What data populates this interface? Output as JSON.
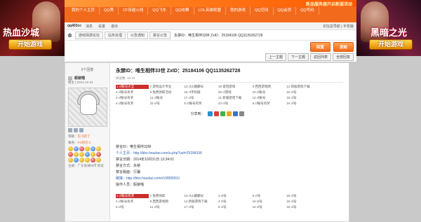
{
  "ads": {
    "left_title": "热血沙城",
    "left_button": "开始游戏",
    "right_title": "黑暗之光",
    "right_button": "开始游戏"
  },
  "top": {
    "banner_text": "新品服务器开启新服活动",
    "nav": [
      "我的个人主页",
      "QQ秀",
      "CF穿越火线",
      "QQ飞车",
      "QQ炫舞",
      "LOL英雄联盟",
      "我的游戏",
      "QQ空间",
      "QQ会员",
      "QQ号码"
    ]
  },
  "userbar": {
    "username": "qq403cc",
    "items": [
      "消息",
      "设置",
      "退出"
    ],
    "right": "论坛总导航 | 手机版"
  },
  "breadcrumb": {
    "items": [
      "游戏情感论坛",
      "站务处理",
      "公告通知",
      "禁言公告"
    ],
    "title": "永禁ID：唯生相伴33世  ZxID：25184106  QQ1135262728"
  },
  "actions": {
    "reply": "回复",
    "post": "发帖"
  },
  "pager": {
    "prev": "上一主题",
    "next": "下一主题",
    "back": "返回列表",
    "all": "全部回复"
  },
  "post": {
    "floor": "0个回复",
    "uid": "楼主 | 2014-10-31",
    "author": "假装喵",
    "rank_label": "等级：",
    "rank_value": "实习新丁",
    "role_label": "角色：",
    "role_value": "PK新社人",
    "location": "注册：广东省潮州市 新浪",
    "title": "永禁ID：唯生相伴33世  ZxID：25184106  QQ1135262728",
    "meta": "阅读数: 10-31",
    "share_label": "分享到：",
    "body_lines": [
      "禁言ID：唯生相伴33世",
      "个人主页：http://bbs.houdao.com/u.php?uid=25184106",
      "禁言日期：2014年10月31日  13:34:01",
      "禁言方式：永禁",
      "禁言版面：行骗",
      "链接：http://bbs.houdao.com/r10892061/",
      "操作人员：假装喵"
    ],
    "ad_links_top": [
      "1 cf账号大全",
      "2 cf账号有奖",
      "3 cf账号有奖",
      "4 cf账号有奖",
      "5 cf账号有奖",
      "6 cf账号有奖",
      "7 游戏设计专业",
      "8 西西游戏网",
      "9 免费领取活动",
      "10 cf账号",
      "11 cf账号",
      "12 cf账号",
      "13 cf火麒麟号",
      "14 新服游戏下载",
      "15 cf手机版",
      "16 cf号",
      "17 cf号",
      "18 cf号",
      "19 冒回游戏",
      "20 cf游戏",
      "21 新服游戏下载",
      "22 cf号",
      "23 cf号",
      "24 cf号"
    ],
    "ad_links_bottom": [
      "1 cf账号有奖",
      "2 cf账号有奖",
      "3 cf号",
      "4 cf号",
      "5 cf号",
      "6 cf号",
      "7 免费领取",
      "8 西西游戏网",
      "9 cf号",
      "10 cf号",
      "11 cf号",
      "12 cf号",
      "13 cf火麒麟号",
      "14 新服游戏下载",
      "15 cf号",
      "16 cf号",
      "17 cf号",
      "18 cf号"
    ]
  }
}
